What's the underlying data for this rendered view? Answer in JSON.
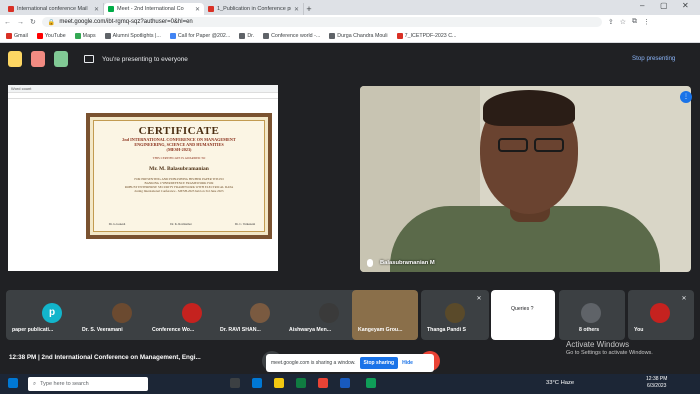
{
  "browser": {
    "tabs": [
      {
        "title": "International conference Mail",
        "color": "#d93025"
      },
      {
        "title": "Meet - 2nd International Co",
        "color": "#00ac47"
      },
      {
        "title": "1_Publication in Conference pro",
        "color": "#d93025"
      }
    ],
    "new_tab": "+",
    "url": "meet.google.com/ibt-rgmq-sqz?authuser=0&hl=en",
    "bookmarks": [
      {
        "label": "Gmail",
        "color": "#d93025"
      },
      {
        "label": "YouTube",
        "color": "#ff0000"
      },
      {
        "label": "Maps",
        "color": "#34a853"
      },
      {
        "label": "Alumni Spotlights |...",
        "color": "#5f6368"
      },
      {
        "label": "Call for Paper @202...",
        "color": "#4285f4"
      },
      {
        "label": "Dr.",
        "color": "#5f6368"
      },
      {
        "label": "Conference world -...",
        "color": "#5f6368"
      },
      {
        "label": "Durga Chandra Mouli",
        "color": "#5f6368"
      },
      {
        "label": "7_ICETPDF-2023 C...",
        "color": "#d93025"
      }
    ]
  },
  "presenting_bar": {
    "text": "You're presenting to everyone",
    "stop_label": "Stop presenting"
  },
  "presentation": {
    "window_title": "Word count",
    "certificate": {
      "title": "CERTIFICATE",
      "conference": "2nd INTERNATIONAL CONFERENCE ON MANAGEMENT",
      "subtitle": "ENGINEERING, SCIENCE AND HUMANITIES",
      "code": "(MESH-2023)",
      "awarded_line": "THIS CERTIFICATE IS AWARDED TO",
      "name": "Mr. M. Balasubramanian",
      "line1": "FOR PRESENTING AND PUBLISHING HIS/HER PAPER TITLED",
      "line2": "BANKING CYBERDEFENCE FRAMEWORK FOR",
      "line3": "ROBUST ENTERPRISE SECURITY FRAMEWORK WITH ELECTRICAL DATA",
      "line4": "during International Conference - MESH-2023 held on 3rd June 2023",
      "sig1": "Dr. G.Ganesh",
      "sig2": "Dr. K. Ravikumar",
      "sig3": "Dr. C. Venkatesh"
    }
  },
  "main_tile": {
    "name": "Balasubramanian M"
  },
  "participants": [
    {
      "name": "paper publicati...",
      "initial": "p",
      "color": "#12b5cb"
    },
    {
      "name": "Dr. S. Veeramani",
      "initial": "",
      "color": "#6b4a30"
    },
    {
      "name": "Conference Wo...",
      "initial": "",
      "color": "#c5221f"
    },
    {
      "name": "Dr. RAVI SHAN...",
      "initial": "",
      "color": "#7a5a40"
    },
    {
      "name": "Aishwarya Men...",
      "initial": "",
      "color": "#3a3a3a"
    },
    {
      "name": "Kangeyam Grou...",
      "initial": "",
      "color": "#8a6f4a"
    },
    {
      "name": "Thanga Pandi S",
      "initial": "",
      "color": "#5a4a2a"
    },
    {
      "name": "Queries ?",
      "initial": "",
      "color": "#ffffff"
    },
    {
      "name": "8 others",
      "initial": "",
      "color": "#5f6368"
    },
    {
      "name": "You",
      "initial": "",
      "color": "#c5221f"
    }
  ],
  "bottom": {
    "meeting_label": "12:38 PM | 2nd International Conference on Management, Engi...",
    "share_notice": "meet.google.com is sharing a window.",
    "stop_sharing": "Stop sharing",
    "hide": "Hide",
    "activate_title": "Activate Windows",
    "activate_sub": "Go to Settings to activate Windows."
  },
  "taskbar": {
    "search_placeholder": "Type here to search",
    "weather": "33°C Haze",
    "time": "12:38 PM",
    "date": "6/3/2023"
  }
}
